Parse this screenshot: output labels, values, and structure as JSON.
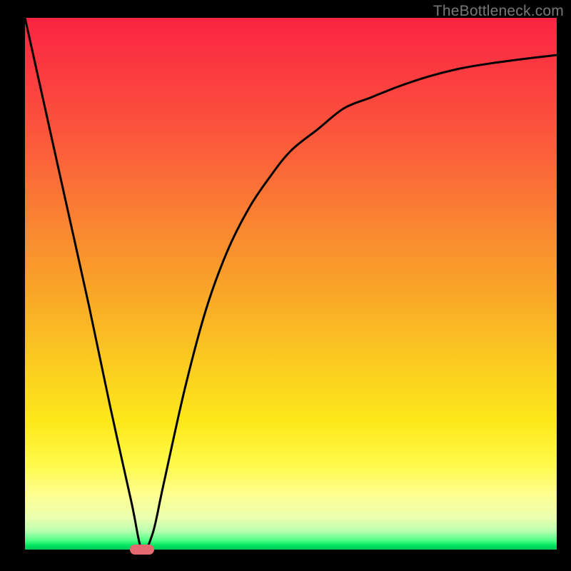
{
  "attribution": "TheBottleneck.com",
  "colors": {
    "gradient_top": "#fb2443",
    "gradient_bottom": "#00c455",
    "curve": "#000000",
    "marker": "#e46a6f",
    "frame": "#000000"
  },
  "chart_data": {
    "type": "line",
    "title": "",
    "xlabel": "",
    "ylabel": "",
    "xlim": [
      0,
      100
    ],
    "ylim": [
      0,
      100
    ],
    "grid": false,
    "series": [
      {
        "name": "bottleneck-curve",
        "x": [
          0,
          4,
          8,
          12,
          16,
          20,
          22,
          24,
          26,
          30,
          34,
          38,
          42,
          46,
          50,
          55,
          60,
          65,
          70,
          76,
          82,
          88,
          94,
          100
        ],
        "y": [
          100,
          82,
          64,
          46,
          27,
          9,
          0,
          3,
          12,
          30,
          45,
          56,
          64,
          70,
          75,
          79,
          83,
          85,
          87,
          89,
          90.5,
          91.5,
          92.3,
          93
        ]
      }
    ],
    "marker": {
      "x": 22,
      "y": 0
    }
  }
}
